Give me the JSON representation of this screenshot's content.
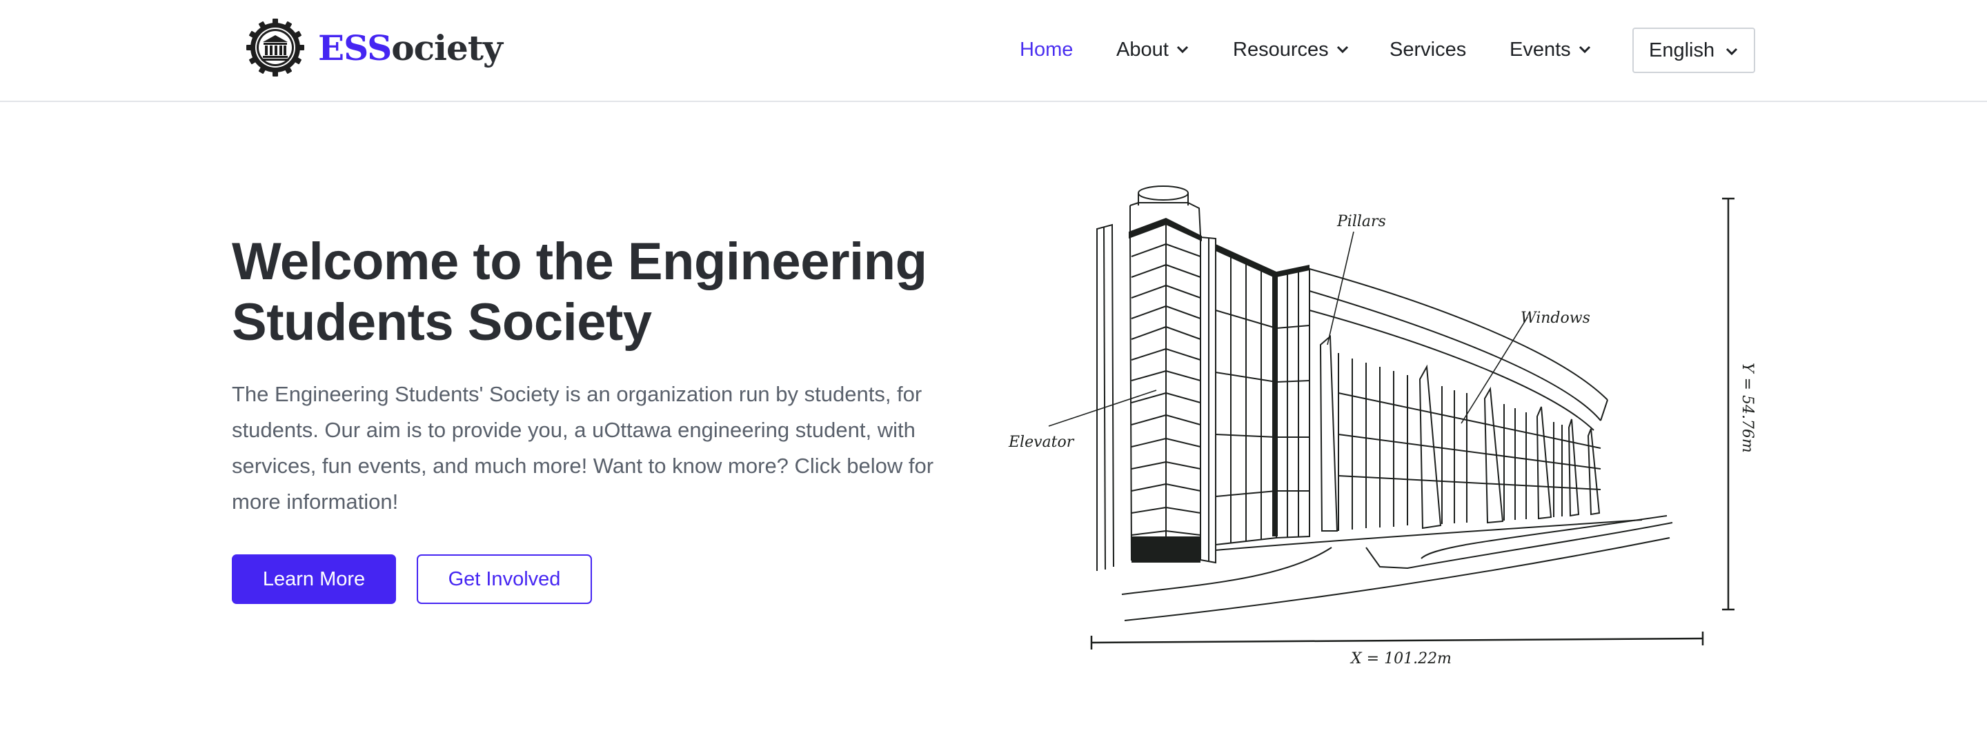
{
  "header": {
    "brand": {
      "accent": "ESS",
      "rest": "ociety",
      "logo_icon": "gear-building-logo-icon"
    },
    "nav": [
      {
        "label": "Home",
        "active": true,
        "dropdown": false
      },
      {
        "label": "About",
        "active": false,
        "dropdown": true
      },
      {
        "label": "Resources",
        "active": false,
        "dropdown": true
      },
      {
        "label": "Services",
        "active": false,
        "dropdown": false
      },
      {
        "label": "Events",
        "active": false,
        "dropdown": true
      }
    ],
    "language": {
      "selected": "English",
      "icon": "chevron-down-icon"
    }
  },
  "hero": {
    "title": "Welcome to the Engineering Students Society",
    "description": "The Engineering Students' Society is an organization run by students, for students. Our aim is to provide you, a uOttawa engineering student, with services, fun events, and much more! Want to know more? Click below for more information!",
    "primary_button": "Learn More",
    "secondary_button": "Get Involved"
  },
  "illustration": {
    "labels": {
      "pillars": "Pillars",
      "windows": "Windows",
      "elevator": "Elevator",
      "width": "X = 101.22m",
      "height": "Y = 54.76m"
    }
  },
  "colors": {
    "accent": "#4525f2",
    "text": "#2b2e33",
    "muted": "#59606b",
    "border": "#e2e4e8"
  }
}
